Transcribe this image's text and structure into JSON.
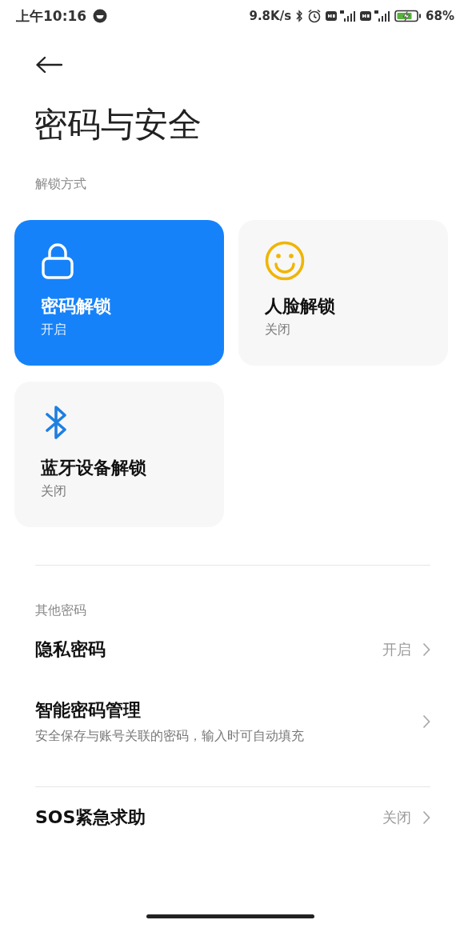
{
  "status_bar": {
    "time": "上午10:16",
    "network_speed": "9.8K/s",
    "battery": "68%"
  },
  "title": "密码与安全",
  "unlock_section": {
    "label": "解锁方式",
    "cards": [
      {
        "kind": "lock",
        "title": "密码解锁",
        "status": "开启",
        "on": true
      },
      {
        "kind": "face",
        "title": "人脸解锁",
        "status": "关闭",
        "on": false
      },
      {
        "kind": "bluetooth",
        "title": "蓝牙设备解锁",
        "status": "关闭",
        "on": false
      }
    ]
  },
  "other_section": {
    "label": "其他密码",
    "rows": [
      {
        "title": "隐私密码",
        "value": "开启"
      },
      {
        "title": "智能密码管理",
        "subtitle": "安全保存与账号关联的密码，输入时可自动填充"
      },
      {
        "title": "SOS紧急求助",
        "value": "关闭"
      }
    ]
  }
}
